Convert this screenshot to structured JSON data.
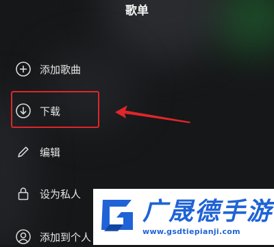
{
  "header": {
    "title": "歌单"
  },
  "menu": {
    "items": [
      {
        "label": "添加歌曲",
        "icon": "plus-circle-icon"
      },
      {
        "label": "下载",
        "icon": "download-circle-icon"
      },
      {
        "label": "编辑",
        "icon": "pencil-icon"
      },
      {
        "label": "设为私人",
        "icon": "lock-icon"
      },
      {
        "label": "添加到个人",
        "icon": "person-icon"
      }
    ]
  },
  "annotation": {
    "highlight_color": "#e0262b"
  },
  "watermark": {
    "title": "广晟德手游",
    "url": "www.gsdtiepianji.com",
    "color": "#1f63d6"
  }
}
